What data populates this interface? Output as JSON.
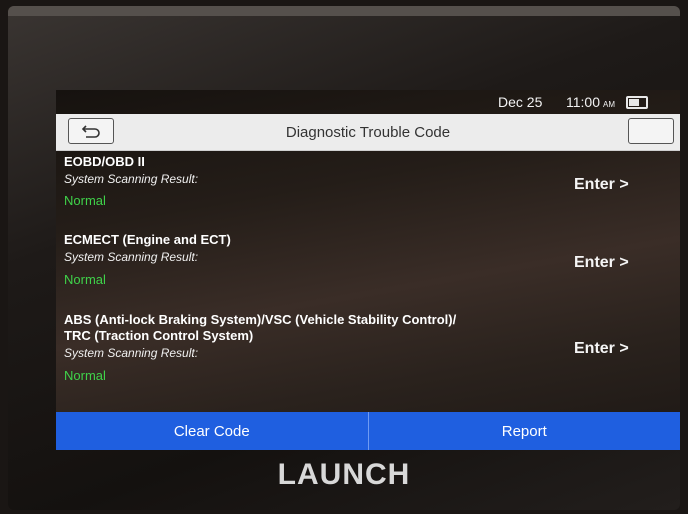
{
  "status": {
    "date": "Dec 25",
    "time": "11:00",
    "ampm": "AM"
  },
  "header": {
    "title": "Diagnostic Trouble Code"
  },
  "items": [
    {
      "title": "EOBD/OBD II",
      "label": "System Scanning Result:",
      "status": "Normal",
      "action": "Enter >"
    },
    {
      "title": "ECMECT (Engine and ECT)",
      "label": "System Scanning Result:",
      "status": "Normal",
      "action": "Enter >"
    },
    {
      "title": "ABS (Anti-lock Braking System)/VSC (Vehicle Stability Control)/",
      "title2": "TRC (Traction Control System)",
      "label": "System Scanning Result:",
      "status": "Normal",
      "action": "Enter >"
    }
  ],
  "footer": {
    "clear_label": "Clear Code",
    "report_label": "Report"
  },
  "brand": "LAUNCH",
  "icons": {
    "back": "back-arrow-icon",
    "battery": "battery-icon"
  },
  "colors": {
    "accent": "#1f5fe0",
    "normal": "#3fd24a"
  }
}
